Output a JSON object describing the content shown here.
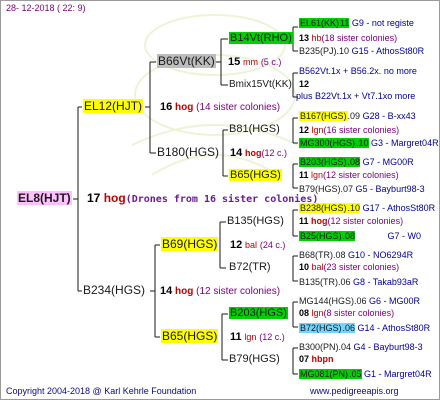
{
  "header_date": "28- 12-2018 ( 22: 9)",
  "footer": {
    "copyright": "Copyright 2004-2018 @ Karl Kehrle Foundation",
    "site": "www.pedigreeapis.org"
  },
  "root": {
    "name": "EL8(HJT)",
    "num": "17",
    "hog": "hog",
    "info": "(Drones from 16 sister colonies)"
  },
  "gen1": [
    {
      "name": "EL12(HJT)",
      "num": "16",
      "hog": "hog",
      "info": "(14 sister colonies)"
    },
    {
      "name": "B234(HGS)",
      "num": "14",
      "hog": "hog",
      "info": "(12 sister colonies)"
    }
  ],
  "gen2": [
    {
      "name": "B66Vt(KK)",
      "num": "15",
      "hog": "mm",
      "info": "(5 c.)"
    },
    {
      "name": "B180(HGS)",
      "num": "14",
      "hog": "hog",
      "info": "(12 c.)"
    },
    {
      "name": "B69(HGS)",
      "num": "12",
      "hog": "bal",
      "info": "(24 c.)"
    },
    {
      "name": "B65(HGS)",
      "num": "11",
      "hog": "lgn",
      "info": "(12 c.)"
    }
  ],
  "gen3": [
    {
      "name": "B14Vt(RHO)",
      "num": "13",
      "hog": "hb",
      "info": "(18 sister colonies)"
    },
    {
      "name": "Bmix15Vt(KK)",
      "num": "12",
      "hog": "",
      "info": "plus B22Vt.1x + Vt7.1xo more"
    },
    {
      "name": "B81(HGS)",
      "num": "12",
      "hog": "lgn",
      "info": "(16 sister colonies)"
    },
    {
      "name": "B65(HGS)",
      "num": "11",
      "hog": "lgn",
      "info": "(12 sister colonies)"
    },
    {
      "name": "B135(HGS)",
      "num": "11",
      "hog": "hog",
      "info": "(12 sister colonies)"
    },
    {
      "name": "B72(TR)",
      "num": "10",
      "hog": "bal",
      "info": "(23 sister colonies)"
    },
    {
      "name": "B203(HGS)",
      "num": "08",
      "hog": "lgn",
      "info": "(8 sister colonies)"
    },
    {
      "name": "B79(HGS)",
      "num": "07",
      "hog": "hbpn",
      "info": ""
    }
  ],
  "gen4": [
    {
      "name": "EL61(KK)",
      "suffix": "11",
      "code": "G9 - not registe"
    },
    {
      "name": "B235(PJ)",
      "suffix": ".10",
      "code": "G15 - AthosSt80R"
    },
    {
      "name": "B562Vt.1x + B56.2x.",
      "suffix": "",
      "code": "no more"
    },
    {
      "name": "B167(HGS)",
      "suffix": ".09",
      "code": "G28 - B-xx43"
    },
    {
      "name": "MG300(HGS)",
      "suffix": ".10",
      "code": "G3 - Margret04R"
    },
    {
      "name": "B203(HGS)",
      "suffix": ".08",
      "code": "G7 - MG00R"
    },
    {
      "name": "B79(HGS)",
      "suffix": ".07",
      "code": "G5 - Bayburt98-3"
    },
    {
      "name": "B238(HGS)",
      "suffix": ".10",
      "code": "G17 - AthosSt80R"
    },
    {
      "name": "B25(HGS)",
      "suffix": ".08",
      "code": "G7 - W0"
    },
    {
      "name": "B68(TR)",
      "suffix": ".08",
      "code": "G10 - NO6294R"
    },
    {
      "name": "B135(TR)",
      "suffix": ".06",
      "code": "G8 - Takab93aR"
    },
    {
      "name": "MG144(HGS)",
      "suffix": ".06",
      "code": "G6 - MG00R"
    },
    {
      "name": "B72(HGS)",
      "suffix": ".06",
      "code": "G14 - AthosSt80R"
    },
    {
      "name": "B300(PN)",
      "suffix": ".04",
      "code": "G4 - Bayburt98-3"
    },
    {
      "name": "MG081(PN)",
      "suffix": ".05",
      "code": "G1 - Margret04R"
    }
  ]
}
